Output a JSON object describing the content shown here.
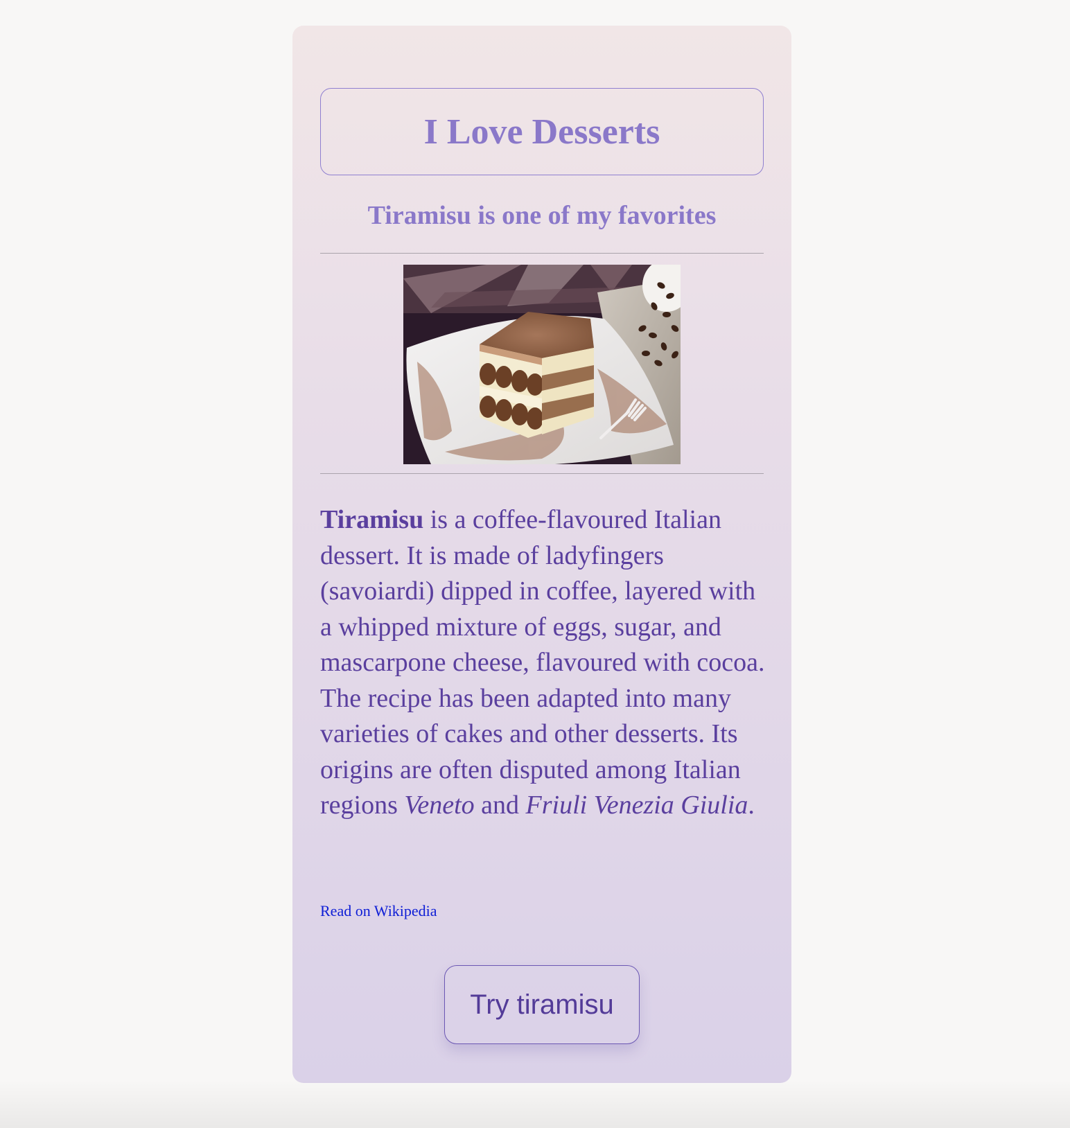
{
  "page": {
    "background_color": "#f8f7f6"
  },
  "card": {
    "gradient_top_color": "#f1e6e7",
    "gradient_bottom_color": "#dad1e8",
    "title": "I Love Desserts",
    "subtitle": "Tiramisu is one of my favorites",
    "image": {
      "alt": "Tiramisu"
    },
    "description": {
      "name": "Tiramisu",
      "part1": " is a coffee-flavoured Italian dessert. It is made of ladyfingers (savoiardi) dipped in coffee, layered with a whipped mixture of eggs, sugar, and mascarpone cheese, flavoured with cocoa. The recipe has been adapted into many varieties of cakes and other desserts. Its origins are often disputed among Italian regions ",
      "region1": "Veneto",
      "connector": " and ",
      "region2": "Friuli Venezia Giulia",
      "ending": "."
    },
    "link_label": "Read on Wikipedia",
    "button_label": "Try tiramisu",
    "accent_color": "#8a78c9",
    "text_color": "#5a3f9e",
    "link_color": "#0e1ed6"
  }
}
